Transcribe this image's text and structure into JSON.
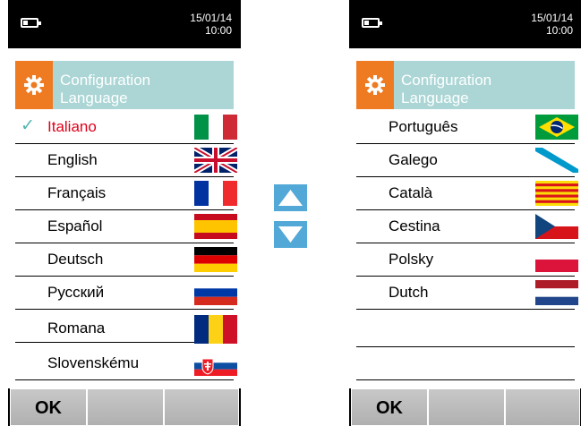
{
  "status": {
    "date": "15/01/14",
    "time": "10:00"
  },
  "header": {
    "line1": "Configuration",
    "line2": "Language"
  },
  "left_list": [
    {
      "label": "Italiano",
      "flag": "italy-flag",
      "selected": true
    },
    {
      "label": "English",
      "flag": "uk-flag",
      "selected": false
    },
    {
      "label": "Français",
      "flag": "france-flag",
      "selected": false
    },
    {
      "label": "Español",
      "flag": "spain-flag",
      "selected": false
    },
    {
      "label": "Deutsch",
      "flag": "germany-flag",
      "selected": false
    },
    {
      "label": "Русский",
      "flag": "russia-flag",
      "selected": false
    },
    {
      "label": "Romana",
      "flag": "romania-flag",
      "selected": false
    },
    {
      "label": "Slovenskému",
      "flag": "slovakia-flag",
      "selected": false
    }
  ],
  "right_list": [
    {
      "label": "Português",
      "flag": "brazil-flag"
    },
    {
      "label": "Galego",
      "flag": "galicia-flag"
    },
    {
      "label": "Català",
      "flag": "catalonia-flag"
    },
    {
      "label": "Cestina",
      "flag": "czech-flag"
    },
    {
      "label": "Polsky",
      "flag": "poland-flag"
    },
    {
      "label": "Dutch",
      "flag": "netherlands-flag"
    },
    {
      "label": "",
      "flag": ""
    },
    {
      "label": "",
      "flag": ""
    }
  ],
  "footer": {
    "ok_label": "OK"
  },
  "colors": {
    "header_bg": "#abd6d5",
    "gear_bg": "#ee7a22",
    "arrow_bg": "#52a9d8",
    "selected_text": "#e0001a",
    "check": "#4fb7ad"
  }
}
